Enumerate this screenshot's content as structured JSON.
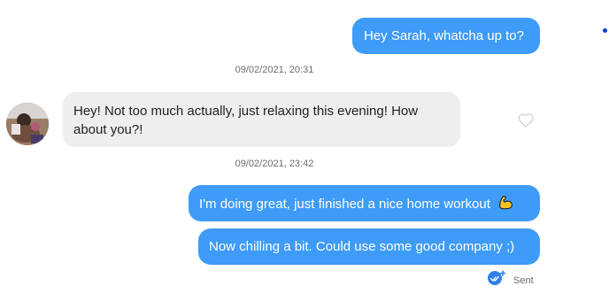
{
  "messages": {
    "m1": {
      "text": "Hey Sarah, whatcha up to?"
    },
    "ts1": "09/02/2021, 20:31",
    "m2": {
      "text": "Hey! Not too much actually, just relaxing this evening! How about you?!"
    },
    "ts2": "09/02/2021, 23:42",
    "m3": {
      "text": "I'm doing great, just finished a nice home workout",
      "emoji": "flexed-biceps-icon"
    },
    "m4": {
      "text": "Now chilling a bit. Could use some good company ;)"
    }
  },
  "status": {
    "sent_label": "Sent"
  },
  "colors": {
    "outgoing_bubble": "#3e9bf7",
    "incoming_bubble": "#eeeeee",
    "dot": "#0a3cd8"
  }
}
